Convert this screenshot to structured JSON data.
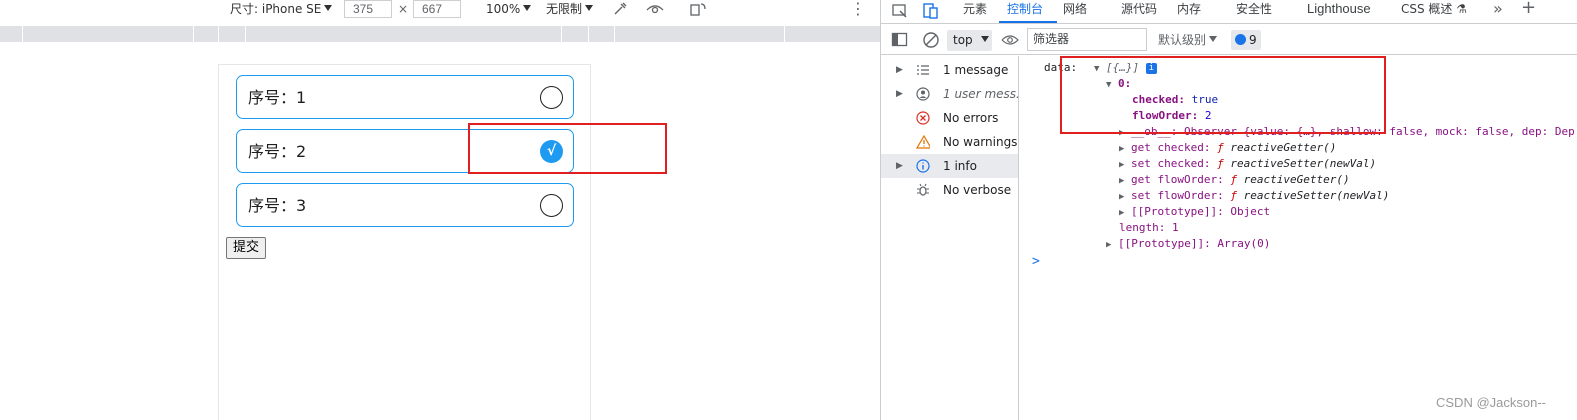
{
  "emulation_toolbar": {
    "device_label": "尺寸: iPhone SE",
    "width": "375",
    "times": "×",
    "height": "667",
    "zoom": "100%",
    "throttle": "无限制",
    "more": "⋮"
  },
  "page": {
    "items": [
      {
        "label": "序号：1",
        "checked": false
      },
      {
        "label": "序号：2",
        "checked": true,
        "check_glyph": "√"
      },
      {
        "label": "序号：3",
        "checked": false
      }
    ],
    "submit_label": "提交"
  },
  "devtools": {
    "tabs": [
      "元素",
      "控制台",
      "网络",
      "源代码",
      "内存",
      "安全性",
      "Lighthouse",
      "CSS 概述 ⚗"
    ],
    "active_tab": "控制台",
    "overflow": "»",
    "add": "+",
    "context": "top",
    "filter_placeholder": "筛选器",
    "levels": "默认级别",
    "issues_count": "9",
    "sidebar": [
      {
        "label": "1 message",
        "icon": "list-icon",
        "selected": false
      },
      {
        "label": "1 user mess...",
        "icon": "user-icon",
        "selected": false
      },
      {
        "label": "No errors",
        "icon": "error-icon",
        "selected": false
      },
      {
        "label": "No warnings",
        "icon": "warning-icon",
        "selected": false
      },
      {
        "label": "1 info",
        "icon": "info-icon",
        "selected": true
      },
      {
        "label": "No verbose",
        "icon": "bug-icon",
        "selected": false
      }
    ],
    "console": {
      "var_name": "data:",
      "summary": "[{…}]",
      "index": "0:",
      "checked_key": "checked:",
      "checked_val": "true",
      "flow_key": "flowOrder:",
      "flow_val": "2",
      "ob_line": "__ob__: Observer {value: {…}, shallow: false, mock: false, dep: Dep",
      "get_checked": "get checked:",
      "set_checked": "set checked:",
      "get_flow": "get flowOrder:",
      "set_flow": "set flowOrder:",
      "getter": "reactiveGetter()",
      "setter": "reactiveSetter(newVal)",
      "f_symbol": "ƒ",
      "proto_obj": "[[Prototype]]: Object",
      "length": "length: 1",
      "proto_arr": "[[Prototype]]: Array(0)",
      "prompt": ">"
    }
  },
  "watermark": "CSDN @Jackson--",
  "colors": {
    "accent": "#1e9bf0",
    "annotation_red": "#e02020",
    "devtools_blue": "#1a73e8"
  }
}
